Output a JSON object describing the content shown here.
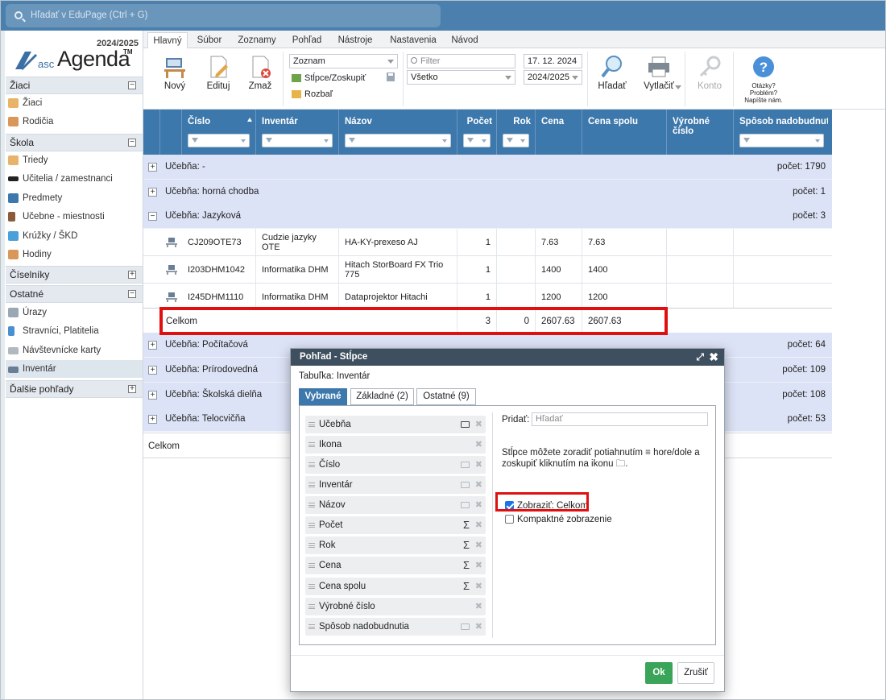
{
  "search": {
    "placeholder": "Hľadať v EduPage (Ctrl + G)"
  },
  "logo": {
    "year": "2024/2025",
    "asc": "asc",
    "agenda": "Agenda",
    "tm": "TM"
  },
  "sidebar": {
    "sections": [
      {
        "label": "Žiaci",
        "toggle": "−"
      },
      {
        "label": "Škola",
        "toggle": "−"
      },
      {
        "label": "Číselníky",
        "toggle": "+"
      },
      {
        "label": "Ostatné",
        "toggle": "−"
      },
      {
        "label": "Ďalšie pohľady",
        "toggle": "+"
      }
    ],
    "items": [
      {
        "label": "Žiaci",
        "icon": "student-icon",
        "color": "#e8b46a"
      },
      {
        "label": "Rodičia",
        "icon": "parents-icon",
        "color": "#d9975a"
      },
      {
        "label": "Triedy",
        "icon": "class-icon",
        "color": "#e8b46a"
      },
      {
        "label": "Učitelia / zamestnanci",
        "icon": "teacher-cap-icon",
        "color": "#222222"
      },
      {
        "label": "Predmety",
        "icon": "book-icon",
        "color": "#3d78ac"
      },
      {
        "label": "Učebne - miestnosti",
        "icon": "door-icon",
        "color": "#8a5a3a"
      },
      {
        "label": "Krúžky / ŠKD",
        "icon": "activity-icon",
        "color": "#4aa0d8"
      },
      {
        "label": "Hodiny",
        "icon": "lessons-icon",
        "color": "#d9975a"
      },
      {
        "label": "Úrazy",
        "icon": "injury-icon",
        "color": "#9aa8b5"
      },
      {
        "label": "Stravníci, Platitelia",
        "icon": "walker-icon",
        "color": "#4a8fd0"
      },
      {
        "label": "Návštevnícke karty",
        "icon": "card-icon",
        "color": "#b0b8c0"
      },
      {
        "label": "Inventár",
        "icon": "inventory-desk-icon",
        "color": "#6a7f95"
      }
    ]
  },
  "tabs": [
    "Hlavný",
    "Súbor",
    "Zoznamy",
    "Pohľad",
    "Nástroje",
    "Nastavenia",
    "Návod"
  ],
  "ribbon": {
    "new": "Nový",
    "edit": "Edituj",
    "delete": "Zmaž",
    "view_select": "Zoznam",
    "columns_group": "Stĺpce/Zoskupiť",
    "expand": "Rozbaľ",
    "filter_placeholder": "Filter",
    "filter_select": "Všetko",
    "date": "17. 12. 2024",
    "year_select": "2024/2025",
    "search": "Hľadať",
    "print": "Vytlačiť",
    "account": "Konto",
    "help": "Otázky? Problém? Napíšte nám."
  },
  "grid": {
    "columns": [
      "Číslo",
      "Inventár",
      "Názov",
      "Počet",
      "Rok",
      "Cena",
      "Cena spolu",
      "Výrobné číslo",
      "Spôsob nadobudnutia"
    ],
    "groups": [
      {
        "label": "Učebňa: -",
        "count": "počet: 1790",
        "toggle": "+"
      },
      {
        "label": "Učebňa: horná chodba",
        "count": "počet: 1",
        "toggle": "+"
      },
      {
        "label": "Učebňa: Jazyková",
        "count": "počet: 3",
        "toggle": "−"
      },
      {
        "label": "Učebňa: Počítačová",
        "count": "počet: 64",
        "toggle": "+"
      },
      {
        "label": "Učebňa: Prírodovedná",
        "count": "počet: 109",
        "toggle": "+"
      },
      {
        "label": "Učebňa: Školská dielňa",
        "count": "počet: 108",
        "toggle": "+"
      },
      {
        "label": "Učebňa: Telocvičňa",
        "count": "počet: 53",
        "toggle": "+"
      }
    ],
    "rows": [
      {
        "cislo": "CJ209OTE73",
        "inventar": "Cudzie jazyky OTE",
        "nazov": "HA-KY-prexeso AJ",
        "pocet": "1",
        "rok": "",
        "cena": "7.63",
        "cena_spolu": "7.63"
      },
      {
        "cislo": "I203DHM1042",
        "inventar": "Informatika DHM",
        "nazov": "Hitach StorBoard FX Trio 775",
        "pocet": "1",
        "rok": "",
        "cena": "1400",
        "cena_spolu": "1400"
      },
      {
        "cislo": "I245DHM1110",
        "inventar": "Informatika DHM",
        "nazov": "Dataprojektor Hitachi",
        "pocet": "1",
        "rok": "",
        "cena": "1200",
        "cena_spolu": "1200"
      }
    ],
    "subtotal": {
      "label": "Celkom",
      "pocet": "3",
      "rok": "0",
      "cena": "2607.63",
      "cena_spolu": "2607.63"
    },
    "footer": "Celkom"
  },
  "dialog": {
    "title": "Pohľad - Stĺpce",
    "subtitle": "Tabuľka: Inventár",
    "tabs": [
      "Vybrané",
      "Základné (2)",
      "Ostatné (9)"
    ],
    "columns": [
      {
        "label": "Učebňa",
        "extra": "folder-on"
      },
      {
        "label": "Ikona",
        "extra": ""
      },
      {
        "label": "Číslo",
        "extra": "folder"
      },
      {
        "label": "Inventár",
        "extra": "folder"
      },
      {
        "label": "Názov",
        "extra": "folder"
      },
      {
        "label": "Počet",
        "extra": "sum"
      },
      {
        "label": "Rok",
        "extra": "sum"
      },
      {
        "label": "Cena",
        "extra": "sum"
      },
      {
        "label": "Cena spolu",
        "extra": "sum"
      },
      {
        "label": "Výrobné číslo",
        "extra": ""
      },
      {
        "label": "Spôsob nadobudnutia",
        "extra": "folder"
      }
    ],
    "add_label": "Pridať:",
    "add_placeholder": "Hľadať",
    "hint": "Stĺpce môžete zoradiť potiahnutím ≡ hore/dole a zoskupiť kliknutím na ikonu 🗀.",
    "show_total": "Zobraziť: Celkom",
    "compact": "Kompaktné zobrazenie",
    "ok": "Ok",
    "cancel": "Zrušiť"
  }
}
